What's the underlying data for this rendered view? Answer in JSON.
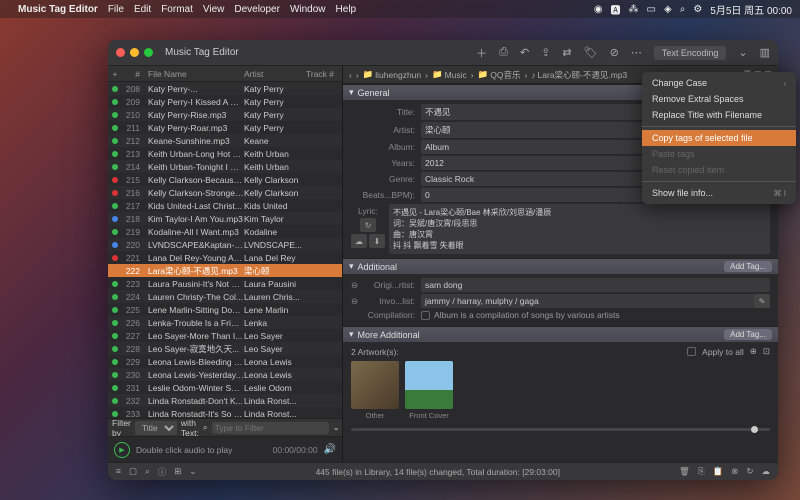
{
  "menubar": {
    "app": "Music Tag Editor",
    "items": [
      "File",
      "Edit",
      "Format",
      "View",
      "Developer",
      "Window",
      "Help"
    ],
    "right": {
      "date": "5月5日 周五 00:00"
    }
  },
  "window": {
    "title": "Music Tag Editor",
    "text_encoding": "Text Encoding"
  },
  "columns": {
    "num": "#",
    "file": "File Name",
    "artist": "Artist",
    "track": "Track #"
  },
  "rows": [
    {
      "n": "208",
      "dot": "d-g",
      "file": "Katy Perry-...",
      "artist": "Katy Perry"
    },
    {
      "n": "209",
      "dot": "d-g",
      "file": "Katy Perry-I Kissed A Gi...",
      "artist": "Katy Perry"
    },
    {
      "n": "210",
      "dot": "d-g",
      "file": "Katy Perry-Rise.mp3",
      "artist": "Katy Perry"
    },
    {
      "n": "211",
      "dot": "d-g",
      "file": "Katy Perry-Roar.mp3",
      "artist": "Katy Perry"
    },
    {
      "n": "212",
      "dot": "d-g",
      "file": "Keane-Sunshine.mp3",
      "artist": "Keane"
    },
    {
      "n": "213",
      "dot": "d-g",
      "file": "Keith Urban-Long Hot S...",
      "artist": "Keith Urban"
    },
    {
      "n": "214",
      "dot": "d-g",
      "file": "Keith Urban-Tonight I W...",
      "artist": "Keith Urban"
    },
    {
      "n": "215",
      "dot": "d-r",
      "file": "Kelly Clarkson-Because...",
      "artist": "Kelly Clarkson"
    },
    {
      "n": "216",
      "dot": "d-r",
      "file": "Kelly Clarkson-Stronger...",
      "artist": "Kelly Clarkson"
    },
    {
      "n": "217",
      "dot": "d-g",
      "file": "Kids United-Last Christ...",
      "artist": "Kids United"
    },
    {
      "n": "218",
      "dot": "d-b",
      "file": "Kim Taylor-I Am You.mp3",
      "artist": "Kim Taylor"
    },
    {
      "n": "219",
      "dot": "d-g",
      "file": "Kodaline-All I Want.mp3",
      "artist": "Kodaline"
    },
    {
      "n": "220",
      "dot": "d-b",
      "file": "LVNDSCAPE&Kaptan-W...",
      "artist": "LVNDSCAPE..."
    },
    {
      "n": "221",
      "dot": "d-r",
      "file": "Lana Del Rey-Young An...",
      "artist": "Lana Del Rey"
    },
    {
      "n": "222",
      "dot": "",
      "file": "Lara梁心颐-不遇见.mp3",
      "artist": "梁心颐",
      "sel": true
    },
    {
      "n": "223",
      "dot": "d-g",
      "file": "Laura Pausini-It's Not G...",
      "artist": "Laura Pausini"
    },
    {
      "n": "224",
      "dot": "d-g",
      "file": "Lauren Christy-The Col...",
      "artist": "Lauren Chris..."
    },
    {
      "n": "225",
      "dot": "d-g",
      "file": "Lene Marlin-Sitting Dow...",
      "artist": "Lene Marlin"
    },
    {
      "n": "226",
      "dot": "d-g",
      "file": "Lenka-Trouble Is a Frien...",
      "artist": "Lenka"
    },
    {
      "n": "227",
      "dot": "d-g",
      "file": "Leo Sayer-More Than I...",
      "artist": "Leo Sayer"
    },
    {
      "n": "228",
      "dot": "d-g",
      "file": "Leo Sayer-寂寞地久天...",
      "artist": "Leo Sayer"
    },
    {
      "n": "229",
      "dot": "d-g",
      "file": "Leona Lewis-Bleeding L...",
      "artist": "Leona Lewis"
    },
    {
      "n": "230",
      "dot": "d-g",
      "file": "Leona Lewis-Yesterday....",
      "artist": "Leona Lewis"
    },
    {
      "n": "231",
      "dot": "d-g",
      "file": "Leslie Odom-Winter Son...",
      "artist": "Leslie Odom"
    },
    {
      "n": "232",
      "dot": "d-g",
      "file": "Linda Ronstadt-Don't K...",
      "artist": "Linda Ronst..."
    },
    {
      "n": "233",
      "dot": "d-g",
      "file": "Linda Ronstadt-It's So E...",
      "artist": "Linda Ronst..."
    }
  ],
  "filter": {
    "by_label": "Filter by",
    "by": "Title",
    "with_label": "with Text:",
    "placeholder": "Type to Filter"
  },
  "player": {
    "text": "Double click audio to play",
    "time": "00:00/00:00"
  },
  "breadcrumb": [
    "liuhengzhun",
    "Music",
    "QQ音乐",
    "Lara梁心颐-不遇见.mp3"
  ],
  "general": {
    "header": "General",
    "title_l": "Title:",
    "title": "不遇见",
    "artist_l": "Artist:",
    "artist": "梁心颐",
    "album_l": "Album:",
    "album": "Album",
    "years_l": "Years:",
    "years": "2012",
    "genre_l": "Genre:",
    "genre": "Classic Rock",
    "bpm_l": "Beats...BPM):",
    "bpm": "0",
    "lyric_l": "Lyric:",
    "lyric": "不遇见 - Lara梁心颐/Bae 林采欣/刘思涵/潘辰\n词：吴斌/唐汉霄/段思思\n曲：唐汉霄\n抖 抖 飘着雪 失着眼"
  },
  "additional": {
    "header": "Additional",
    "addtag": "Add Tag...",
    "orig_l": "Origi...rtist:",
    "orig": "sam dong",
    "invo_l": "Invo...list:",
    "invo": "jammy / harray, mulphy / gaga",
    "comp_l": "Compilation:",
    "comp": "Album is a compilation of songs by various artists"
  },
  "more": {
    "header": "More Additional",
    "addtag": "Add Tag...",
    "artcount": "2 Artwork(s):",
    "apply": "Apply to all",
    "thumb1": "Other",
    "thumb2": "Front Cover"
  },
  "status": {
    "text": "445 file(s) in Library, 14 file(s) changed, Total duration: [29:03:00]"
  },
  "ctx": {
    "change": "Change Case",
    "remove": "Remove Extral Spaces",
    "replace": "Replace Title with Filename",
    "copy": "Copy tags of selected file",
    "paste": "Paste tags",
    "reset": "Reset copied item",
    "show": "Show file info...",
    "kbd": "⌘ I"
  }
}
